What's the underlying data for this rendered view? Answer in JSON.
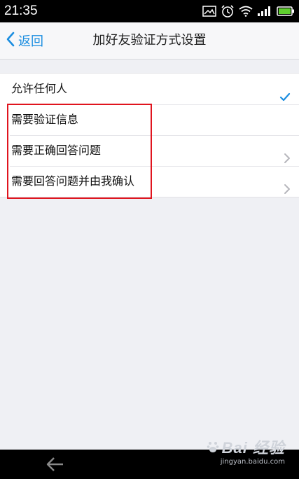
{
  "status_bar": {
    "time": "21:35",
    "icons": [
      "image-icon",
      "alarm-icon",
      "wifi-icon",
      "signal-icon",
      "battery-icon"
    ]
  },
  "nav": {
    "back_label": "返回",
    "title": "加好友验证方式设置"
  },
  "options": [
    {
      "label": "允许任何人",
      "indicator": "check"
    },
    {
      "label": "需要验证信息",
      "indicator": "none"
    },
    {
      "label": "需要正确回答问题",
      "indicator": "chevron"
    },
    {
      "label": "需要回答问题并由我确认",
      "indicator": "chevron"
    }
  ],
  "colors": {
    "accent": "#1a8de0",
    "highlight": "#e0141e",
    "background": "#eff0f4"
  },
  "watermark": {
    "logo": "Bai 经验",
    "url": "jingyan.baidu.com"
  }
}
